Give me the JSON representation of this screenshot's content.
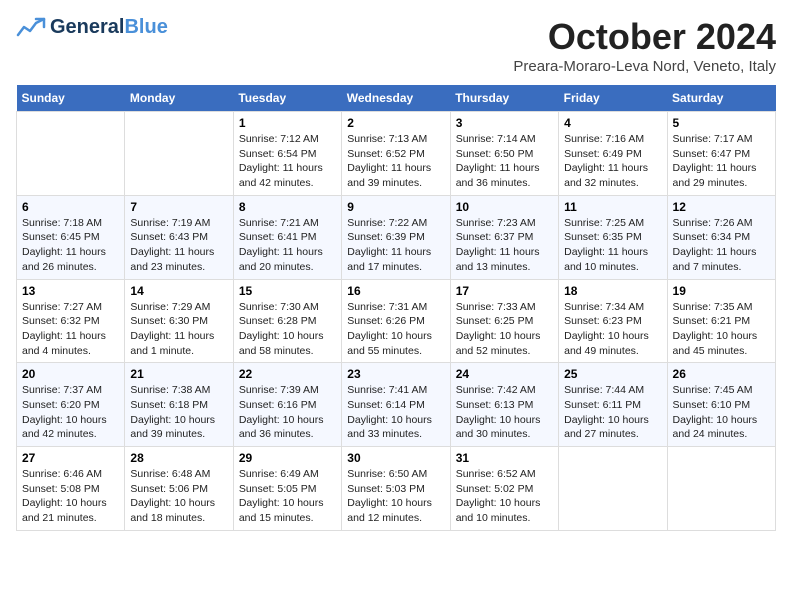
{
  "header": {
    "logo_general": "General",
    "logo_blue": "Blue",
    "month_title": "October 2024",
    "location": "Preara-Moraro-Leva Nord, Veneto, Italy"
  },
  "weekdays": [
    "Sunday",
    "Monday",
    "Tuesday",
    "Wednesday",
    "Thursday",
    "Friday",
    "Saturday"
  ],
  "weeks": [
    [
      {
        "day": "",
        "info": ""
      },
      {
        "day": "",
        "info": ""
      },
      {
        "day": "1",
        "info": "Sunrise: 7:12 AM\nSunset: 6:54 PM\nDaylight: 11 hours and 42 minutes."
      },
      {
        "day": "2",
        "info": "Sunrise: 7:13 AM\nSunset: 6:52 PM\nDaylight: 11 hours and 39 minutes."
      },
      {
        "day": "3",
        "info": "Sunrise: 7:14 AM\nSunset: 6:50 PM\nDaylight: 11 hours and 36 minutes."
      },
      {
        "day": "4",
        "info": "Sunrise: 7:16 AM\nSunset: 6:49 PM\nDaylight: 11 hours and 32 minutes."
      },
      {
        "day": "5",
        "info": "Sunrise: 7:17 AM\nSunset: 6:47 PM\nDaylight: 11 hours and 29 minutes."
      }
    ],
    [
      {
        "day": "6",
        "info": "Sunrise: 7:18 AM\nSunset: 6:45 PM\nDaylight: 11 hours and 26 minutes."
      },
      {
        "day": "7",
        "info": "Sunrise: 7:19 AM\nSunset: 6:43 PM\nDaylight: 11 hours and 23 minutes."
      },
      {
        "day": "8",
        "info": "Sunrise: 7:21 AM\nSunset: 6:41 PM\nDaylight: 11 hours and 20 minutes."
      },
      {
        "day": "9",
        "info": "Sunrise: 7:22 AM\nSunset: 6:39 PM\nDaylight: 11 hours and 17 minutes."
      },
      {
        "day": "10",
        "info": "Sunrise: 7:23 AM\nSunset: 6:37 PM\nDaylight: 11 hours and 13 minutes."
      },
      {
        "day": "11",
        "info": "Sunrise: 7:25 AM\nSunset: 6:35 PM\nDaylight: 11 hours and 10 minutes."
      },
      {
        "day": "12",
        "info": "Sunrise: 7:26 AM\nSunset: 6:34 PM\nDaylight: 11 hours and 7 minutes."
      }
    ],
    [
      {
        "day": "13",
        "info": "Sunrise: 7:27 AM\nSunset: 6:32 PM\nDaylight: 11 hours and 4 minutes."
      },
      {
        "day": "14",
        "info": "Sunrise: 7:29 AM\nSunset: 6:30 PM\nDaylight: 11 hours and 1 minute."
      },
      {
        "day": "15",
        "info": "Sunrise: 7:30 AM\nSunset: 6:28 PM\nDaylight: 10 hours and 58 minutes."
      },
      {
        "day": "16",
        "info": "Sunrise: 7:31 AM\nSunset: 6:26 PM\nDaylight: 10 hours and 55 minutes."
      },
      {
        "day": "17",
        "info": "Sunrise: 7:33 AM\nSunset: 6:25 PM\nDaylight: 10 hours and 52 minutes."
      },
      {
        "day": "18",
        "info": "Sunrise: 7:34 AM\nSunset: 6:23 PM\nDaylight: 10 hours and 49 minutes."
      },
      {
        "day": "19",
        "info": "Sunrise: 7:35 AM\nSunset: 6:21 PM\nDaylight: 10 hours and 45 minutes."
      }
    ],
    [
      {
        "day": "20",
        "info": "Sunrise: 7:37 AM\nSunset: 6:20 PM\nDaylight: 10 hours and 42 minutes."
      },
      {
        "day": "21",
        "info": "Sunrise: 7:38 AM\nSunset: 6:18 PM\nDaylight: 10 hours and 39 minutes."
      },
      {
        "day": "22",
        "info": "Sunrise: 7:39 AM\nSunset: 6:16 PM\nDaylight: 10 hours and 36 minutes."
      },
      {
        "day": "23",
        "info": "Sunrise: 7:41 AM\nSunset: 6:14 PM\nDaylight: 10 hours and 33 minutes."
      },
      {
        "day": "24",
        "info": "Sunrise: 7:42 AM\nSunset: 6:13 PM\nDaylight: 10 hours and 30 minutes."
      },
      {
        "day": "25",
        "info": "Sunrise: 7:44 AM\nSunset: 6:11 PM\nDaylight: 10 hours and 27 minutes."
      },
      {
        "day": "26",
        "info": "Sunrise: 7:45 AM\nSunset: 6:10 PM\nDaylight: 10 hours and 24 minutes."
      }
    ],
    [
      {
        "day": "27",
        "info": "Sunrise: 6:46 AM\nSunset: 5:08 PM\nDaylight: 10 hours and 21 minutes."
      },
      {
        "day": "28",
        "info": "Sunrise: 6:48 AM\nSunset: 5:06 PM\nDaylight: 10 hours and 18 minutes."
      },
      {
        "day": "29",
        "info": "Sunrise: 6:49 AM\nSunset: 5:05 PM\nDaylight: 10 hours and 15 minutes."
      },
      {
        "day": "30",
        "info": "Sunrise: 6:50 AM\nSunset: 5:03 PM\nDaylight: 10 hours and 12 minutes."
      },
      {
        "day": "31",
        "info": "Sunrise: 6:52 AM\nSunset: 5:02 PM\nDaylight: 10 hours and 10 minutes."
      },
      {
        "day": "",
        "info": ""
      },
      {
        "day": "",
        "info": ""
      }
    ]
  ]
}
